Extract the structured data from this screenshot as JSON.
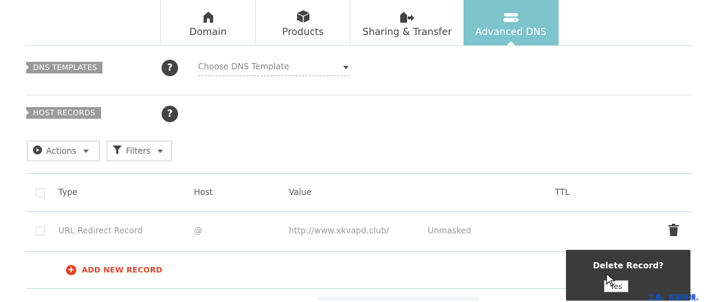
{
  "tabs": [
    {
      "label": "Domain",
      "icon": "home-icon",
      "active": false
    },
    {
      "label": "Products",
      "icon": "box-icon",
      "active": false
    },
    {
      "label": "Sharing & Transfer",
      "icon": "transfer-icon",
      "active": false
    },
    {
      "label": "Advanced DNS",
      "icon": "dns-server-icon",
      "active": true
    }
  ],
  "dns_templates": {
    "label": "DNS TEMPLATES",
    "help": "?",
    "select_value": "Choose DNS Template"
  },
  "host_records": {
    "label": "HOST RECORDS",
    "help": "?"
  },
  "toolbar": {
    "actions_label": "Actions",
    "filters_label": "Filters"
  },
  "table": {
    "headers": {
      "type": "Type",
      "host": "Host",
      "value": "Value",
      "ttl": "TTL"
    },
    "rows": [
      {
        "type": "URL Redirect Record",
        "host": "@",
        "value": "http://www.xkvapd.club/",
        "mode": "Unmasked"
      }
    ]
  },
  "add_record_label": "ADD NEW RECORD",
  "delete_popover": {
    "title": "Delete Record?",
    "yes_label": "Yes"
  },
  "overlay_text": "工具、实验环境、",
  "colors": {
    "active_tab": "#7dc4cc",
    "add_record": "#d6452d",
    "popover_bg": "#3b3b3b"
  }
}
